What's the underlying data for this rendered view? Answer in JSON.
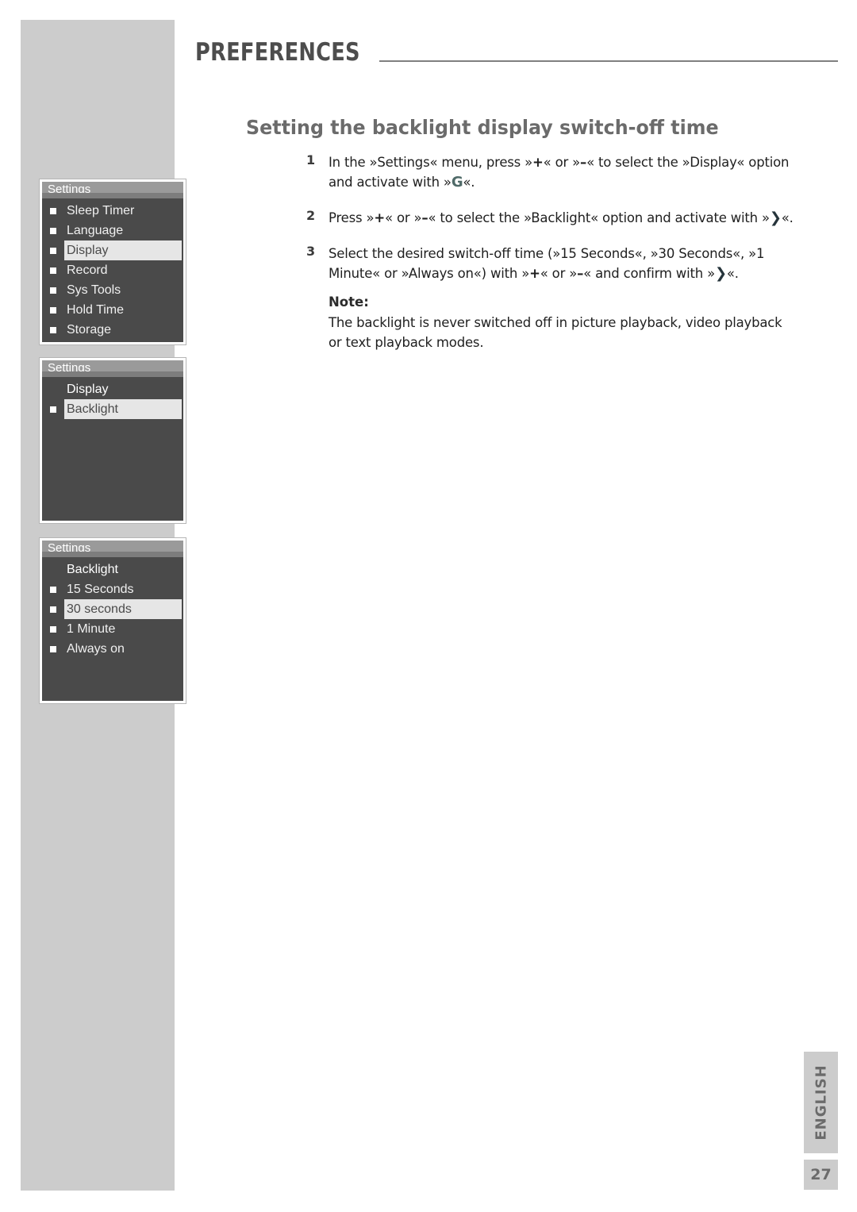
{
  "header": {
    "title": "PREFERENCES"
  },
  "section": {
    "heading": "Setting the backlight display switch-off time"
  },
  "steps": [
    {
      "number": "1",
      "text_pre": "In the »Settings« menu, press »",
      "key_a": "+",
      "text_mid": "« or »",
      "key_b": "–",
      "text_post": "« to select the »Display« option and activate with »",
      "glyph": "G",
      "text_end": "«."
    },
    {
      "number": "2",
      "text_pre": "Press »",
      "key_a": "+",
      "text_mid": "« or »",
      "key_b": "–",
      "text_post": "« to select the »Backlight« option and activate with »",
      "glyph": "❯",
      "text_end": "«."
    },
    {
      "number": "3",
      "text_pre": "Select the desired switch-off time (»15 Seconds«, »30 Seconds«, »1 Minute« or »Always on«) with »",
      "key_a": "+",
      "text_mid": "« or »",
      "key_b": "–",
      "text_post": "« and confirm with »",
      "glyph": "❯",
      "text_end": "«."
    }
  ],
  "note": {
    "label": "Note:",
    "text": "The backlight is never switched off in picture playback, video playback or text playback modes."
  },
  "screens": [
    {
      "title": "Settings",
      "rows": [
        {
          "label": "Sleep Timer",
          "bullet": true,
          "selected": false
        },
        {
          "label": "Language",
          "bullet": true,
          "selected": false
        },
        {
          "label": "Display",
          "bullet": true,
          "selected": true
        },
        {
          "label": "Record",
          "bullet": true,
          "selected": false
        },
        {
          "label": "Sys Tools",
          "bullet": true,
          "selected": false
        },
        {
          "label": "Hold Time",
          "bullet": true,
          "selected": false
        },
        {
          "label": "Storage",
          "bullet": true,
          "selected": false
        }
      ]
    },
    {
      "title": "Settings",
      "rows": [
        {
          "label": "Display",
          "bullet": false,
          "selected": false
        },
        {
          "label": "Backlight",
          "bullet": true,
          "selected": true
        }
      ]
    },
    {
      "title": "Settings",
      "rows": [
        {
          "label": "Backlight",
          "bullet": false,
          "selected": false
        },
        {
          "label": "15 Seconds",
          "bullet": true,
          "selected": false
        },
        {
          "label": "30 seconds",
          "bullet": true,
          "selected": true
        },
        {
          "label": "1 Minute",
          "bullet": true,
          "selected": false
        },
        {
          "label": "Always on",
          "bullet": true,
          "selected": false
        }
      ]
    }
  ],
  "footer": {
    "language": "ENGLISH",
    "page_number": "27"
  },
  "colors": {
    "band_gray": "#cccccc",
    "heading_gray": "#6b6b6b",
    "screen_bg": "#4a4a4a",
    "screen_titlebar": "#9a9a9a",
    "highlight": "#e6e6e6",
    "glyph_teal": "#4f6a68"
  }
}
